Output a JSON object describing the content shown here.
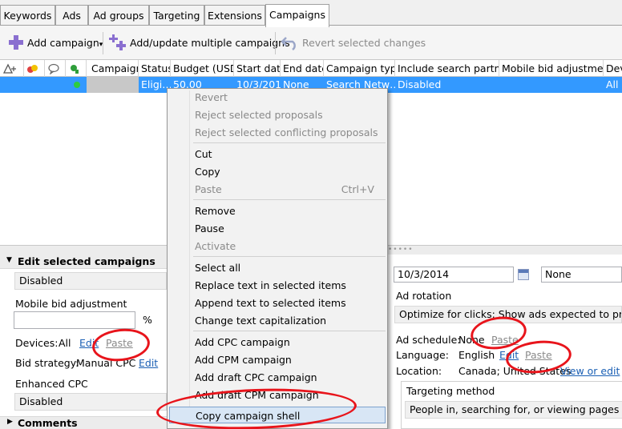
{
  "tabs": [
    "Keywords",
    "Ads",
    "Ad groups",
    "Targeting",
    "Extensions",
    "Campaigns"
  ],
  "toolbar": {
    "add_campaign": "Add campaign",
    "add_update_multiple": "Add/update multiple campaigns",
    "revert_changes": "Revert selected changes"
  },
  "grid": {
    "columns": [
      "Campaign",
      "Status",
      "Budget (USD)",
      "Start date",
      "End date",
      "Campaign type",
      "Include search partners",
      "Mobile bid adjustment",
      "Dev"
    ],
    "row": {
      "status": "Eligi…",
      "budget": "50.00",
      "start_date": "10/3/2014",
      "end_date": "None",
      "campaign_type": "Search Netw…",
      "search_partners": "Disabled",
      "devices": "All"
    }
  },
  "left_panel": {
    "title": "Edit selected campaigns",
    "top_value": "Disabled",
    "mobile_bid_label": "Mobile bid adjustment",
    "mobile_bid_value": "",
    "percent": "%",
    "devices_label": "Devices:",
    "devices_value": "All",
    "edit": "Edit",
    "paste": "Paste",
    "bid_strategy_label": "Bid strategy:",
    "bid_strategy_value": "Manual CPC",
    "enhanced_cpc_label": "Enhanced CPC",
    "enhanced_cpc_value": "Disabled",
    "comments": "Comments"
  },
  "right_panel": {
    "start_date": "10/3/2014",
    "end_date": "None",
    "ad_rotation_label": "Ad rotation",
    "ad_rotation_value": "Optimize for clicks: Show ads expected to provide more clicks",
    "ad_schedule_label": "Ad schedule:",
    "ad_schedule_value": "None",
    "language_label": "Language:",
    "language_value": "English",
    "location_label": "Location:",
    "location_value": "Canada; United States",
    "view_or_edit": "View or edit",
    "edit": "Edit",
    "paste": "Paste",
    "targeting_method_label": "Targeting method",
    "targeting_method_value": "People in, searching for, or viewing pages about my targeted location"
  },
  "context_menu": {
    "group1": [
      "Revert",
      "Reject selected proposals",
      "Reject selected conflicting proposals"
    ],
    "group2": [
      "Cut",
      "Copy",
      "Paste"
    ],
    "paste_shortcut": "Ctrl+V",
    "group3": [
      "Remove",
      "Pause",
      "Activate"
    ],
    "group4": [
      "Select all",
      "Replace text in selected items",
      "Append text to selected items",
      "Change text capitalization"
    ],
    "group5": [
      "Add CPC campaign",
      "Add CPM campaign",
      "Add draft CPC campaign",
      "Add draft CPM campaign",
      "Copy campaign shell"
    ]
  },
  "colors": {
    "selection": "#3399ff",
    "annotation": "#e8141b",
    "link": "#1a5fb4",
    "menu_highlight": "#d8e6f5"
  }
}
